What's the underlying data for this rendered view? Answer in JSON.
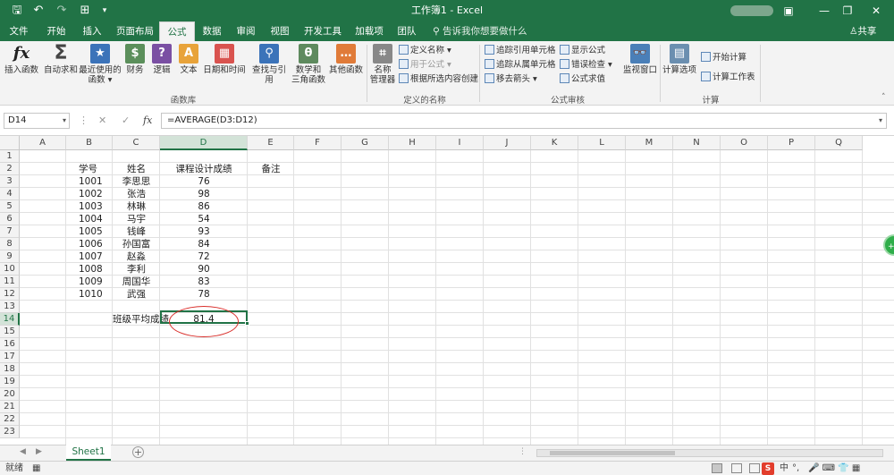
{
  "titlebar": {
    "title": "工作簿1 - Excel",
    "save_icon": "save-icon",
    "undo_icon": "undo-icon",
    "redo_icon": "redo-icon",
    "minimize": "—",
    "restore": "❐",
    "close": "✕",
    "ribbon_display": "▣"
  },
  "tabs": {
    "items": [
      "文件",
      "开始",
      "插入",
      "页面布局",
      "公式",
      "数据",
      "审阅",
      "视图",
      "开发工具",
      "加载项",
      "团队"
    ],
    "active": "公式",
    "tell_me": "告诉我你想要做什么",
    "share": "共享"
  },
  "ribbon": {
    "insert_function": "插入函数",
    "autosum": "自动求和",
    "recent_used": "最近使用的",
    "recent_used2": "函数",
    "financial": "财务",
    "logical": "逻辑",
    "text": "文本",
    "datetime": "日期和时间",
    "lookup": "查找与引用",
    "math": "数学和",
    "math2": "三角函数",
    "more": "其他函数",
    "group_library": "函数库",
    "name_manager": "名称",
    "name_manager2": "管理器",
    "define_name": "定义名称",
    "use_in_formula": "用于公式",
    "create_from_selection": "根据所选内容创建",
    "group_names": "定义的名称",
    "trace_precedents": "追踪引用单元格",
    "trace_dependents": "追踪从属单元格",
    "remove_arrows": "移去箭头",
    "show_formulas": "显示公式",
    "error_checking": "错误检查",
    "evaluate_formula": "公式求值",
    "watch_window": "监视窗口",
    "group_audit": "公式审核",
    "calc_options": "计算选项",
    "calc_now": "开始计算",
    "calc_sheet": "计算工作表",
    "group_calc": "计算"
  },
  "formula_bar": {
    "name_box": "D14",
    "cancel": "✕",
    "enter": "✓",
    "fx": "fx",
    "formula": "=AVERAGE(D3:D12)"
  },
  "grid": {
    "columns": [
      "A",
      "B",
      "C",
      "D",
      "E",
      "F",
      "G",
      "H",
      "I",
      "J",
      "K",
      "L",
      "M",
      "N",
      "O",
      "P",
      "Q"
    ],
    "rows": [
      "1",
      "2",
      "3",
      "4",
      "5",
      "6",
      "7",
      "8",
      "9",
      "10",
      "11",
      "12",
      "13",
      "14",
      "15",
      "16",
      "17",
      "18",
      "19",
      "20",
      "21",
      "22",
      "23"
    ],
    "headers": {
      "id": "学号",
      "name": "姓名",
      "score": "课程设计成绩",
      "note": "备注"
    },
    "students": [
      {
        "id": "1001",
        "name": "李思思",
        "score": "76"
      },
      {
        "id": "1002",
        "name": "张浩",
        "score": "98"
      },
      {
        "id": "1003",
        "name": "林琳",
        "score": "86"
      },
      {
        "id": "1004",
        "name": "马宇",
        "score": "54"
      },
      {
        "id": "1005",
        "name": "钱峰",
        "score": "93"
      },
      {
        "id": "1006",
        "name": "孙国富",
        "score": "84"
      },
      {
        "id": "1007",
        "name": "赵淼",
        "score": "72"
      },
      {
        "id": "1008",
        "name": "李利",
        "score": "90"
      },
      {
        "id": "1009",
        "name": "周国华",
        "score": "83"
      },
      {
        "id": "1010",
        "name": "武强",
        "score": "78"
      }
    ],
    "average_label": "班级平均成绩",
    "average_value": "81.4",
    "side_badge": "+2"
  },
  "sheets": {
    "tabs": [
      "Sheet1"
    ],
    "add": "+"
  },
  "status": {
    "ready": "就绪",
    "tray_ime": "中",
    "tray_dot": "°,",
    "tray_icons": "🎤 ⌨ 👕 ▦"
  }
}
